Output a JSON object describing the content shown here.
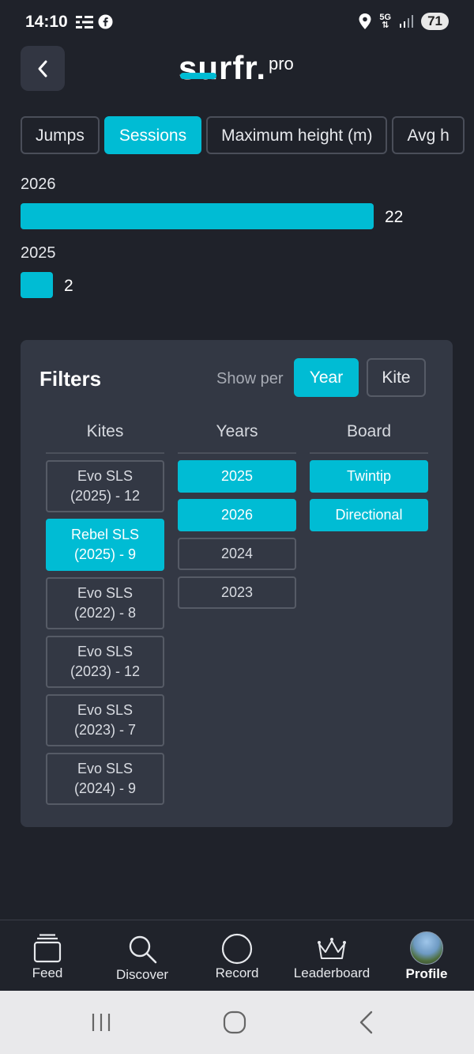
{
  "status_bar": {
    "time": "14:10",
    "network": "5G",
    "battery": "71"
  },
  "header": {
    "logo_main": "surfr.",
    "logo_sup": "pro"
  },
  "metric_tabs": [
    {
      "label": "Jumps",
      "active": false
    },
    {
      "label": "Sessions",
      "active": true
    },
    {
      "label": "Maximum height (m)",
      "active": false
    },
    {
      "label": "Avg h",
      "active": false
    }
  ],
  "chart_data": {
    "type": "bar",
    "orientation": "horizontal",
    "categories": [
      "2026",
      "2025"
    ],
    "values": [
      22,
      2
    ],
    "color": "#00bcd4"
  },
  "filters": {
    "title": "Filters",
    "show_per_label": "Show per",
    "show_per_options": [
      {
        "label": "Year",
        "active": true
      },
      {
        "label": "Kite",
        "active": false
      }
    ],
    "kites_header": "Kites",
    "years_header": "Years",
    "board_header": "Board",
    "kites": [
      {
        "line1": "Evo SLS",
        "line2": "(2025) - 12",
        "active": false
      },
      {
        "line1": "Rebel SLS",
        "line2": "(2025) - 9",
        "active": true
      },
      {
        "line1": "Evo SLS",
        "line2": "(2022) - 8",
        "active": false
      },
      {
        "line1": "Evo SLS",
        "line2": "(2023) - 12",
        "active": false
      },
      {
        "line1": "Evo SLS",
        "line2": "(2023) - 7",
        "active": false
      },
      {
        "line1": "Evo SLS",
        "line2": "(2024) - 9",
        "active": false
      }
    ],
    "years": [
      {
        "label": "2025",
        "active": true
      },
      {
        "label": "2026",
        "active": true
      },
      {
        "label": "2024",
        "active": false
      },
      {
        "label": "2023",
        "active": false
      }
    ],
    "boards": [
      {
        "label": "Twintip",
        "active": true
      },
      {
        "label": "Directional",
        "active": true
      }
    ]
  },
  "bottom_nav": [
    {
      "label": "Feed",
      "icon": "feed-icon"
    },
    {
      "label": "Discover",
      "icon": "search-icon"
    },
    {
      "label": "Record",
      "icon": "record-icon"
    },
    {
      "label": "Leaderboard",
      "icon": "crown-icon"
    },
    {
      "label": "Profile",
      "icon": "avatar"
    }
  ],
  "colors": {
    "accent": "#00bcd4",
    "background": "#1f222a",
    "card": "#333844"
  }
}
